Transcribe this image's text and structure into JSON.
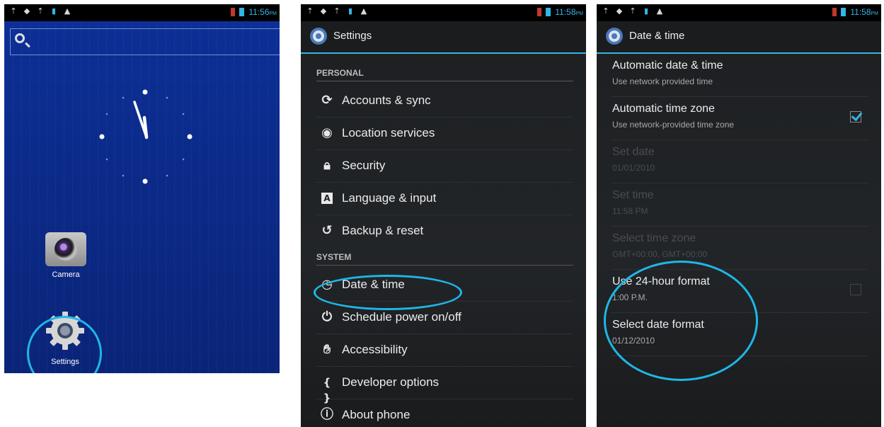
{
  "home": {
    "status_time": "11:56",
    "status_ampm": "PM",
    "apps": [
      {
        "label": "Camera",
        "icon": "camera-icon"
      },
      {
        "label": "Settings",
        "icon": "gear-icon"
      }
    ]
  },
  "settings": {
    "status_time": "11:58",
    "status_ampm": "PM",
    "title": "Settings",
    "sections": {
      "personal": "PERSONAL",
      "system": "SYSTEM"
    },
    "personal_items": [
      {
        "label": "Accounts & sync",
        "icon": "sync-icon"
      },
      {
        "label": "Location services",
        "icon": "location-icon"
      },
      {
        "label": "Security",
        "icon": "lock-icon"
      },
      {
        "label": "Language & input",
        "icon": "keyboard-icon"
      },
      {
        "label": "Backup & reset",
        "icon": "backup-icon"
      }
    ],
    "system_items": [
      {
        "label": "Date & time",
        "icon": "clock-icon"
      },
      {
        "label": "Schedule power on/off",
        "icon": "power-icon"
      },
      {
        "label": "Accessibility",
        "icon": "hand-icon"
      },
      {
        "label": "Developer options",
        "icon": "braces-icon"
      },
      {
        "label": "About phone",
        "icon": "info-icon"
      }
    ]
  },
  "datetime": {
    "status_time": "11:58",
    "status_ampm": "PM",
    "title": "Date & time",
    "rows": [
      {
        "title": "Automatic date & time",
        "summary": "Use network provided time"
      },
      {
        "title": "Automatic time zone",
        "summary": "Use network-provided time zone",
        "checked": true
      },
      {
        "title": "Set date",
        "summary": "01/01/2010",
        "disabled": true
      },
      {
        "title": "Set time",
        "summary": "11:58 PM",
        "disabled": true
      },
      {
        "title": "Select time zone",
        "summary": "GMT+00:00, GMT+00:00",
        "disabled": true
      },
      {
        "title": "Use 24-hour format",
        "summary": "1:00 P.M.",
        "checked": false
      },
      {
        "title": "Select date format",
        "summary": "01/12/2010"
      }
    ]
  },
  "colors": {
    "accent": "#33b5e5",
    "highlight_circle": "#1fb6e6",
    "home_background": "#0c2f96"
  }
}
